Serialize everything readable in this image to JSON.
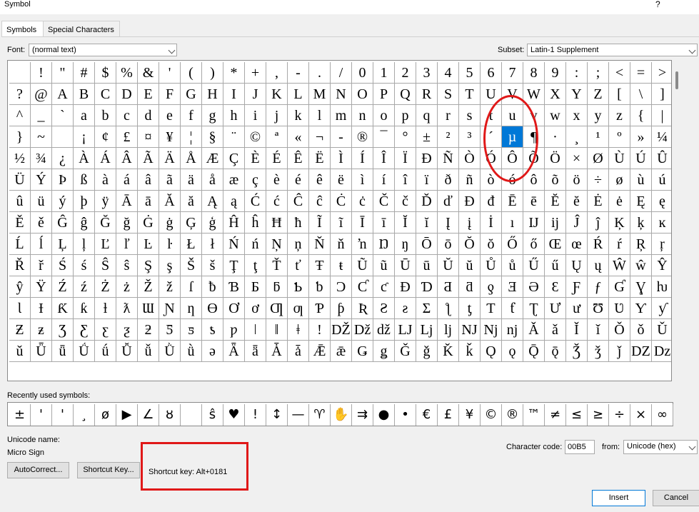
{
  "window": {
    "title": "Symbol",
    "help": "?"
  },
  "tabs": [
    {
      "label": "Symbols"
    },
    {
      "label": "Special Characters"
    }
  ],
  "font": {
    "label": "Font:",
    "value": "(normal text)"
  },
  "subset": {
    "label": "Subset:",
    "value": "Latin-1 Supplement"
  },
  "grid": {
    "rows": [
      [
        "",
        "!",
        "\"",
        "#",
        "$",
        "%",
        "&",
        "'",
        "(",
        ")",
        "*",
        "+",
        ",",
        "-",
        ".",
        "/",
        "0",
        "1",
        "2",
        "3",
        "4",
        "5",
        "6",
        "7",
        "8",
        "9",
        ":",
        ";",
        "<",
        "=",
        ">"
      ],
      [
        "?",
        "@",
        "A",
        "B",
        "C",
        "D",
        "E",
        "F",
        "G",
        "H",
        "I",
        "J",
        "K",
        "L",
        "M",
        "N",
        "O",
        "P",
        "Q",
        "R",
        "S",
        "T",
        "U",
        "V",
        "W",
        "X",
        "Y",
        "Z",
        "[",
        "\\",
        "]"
      ],
      [
        "^",
        "_",
        "`",
        "a",
        "b",
        "c",
        "d",
        "e",
        "f",
        "g",
        "h",
        "i",
        "j",
        "k",
        "l",
        "m",
        "n",
        "o",
        "p",
        "q",
        "r",
        "s",
        "t",
        "u",
        "v",
        "w",
        "x",
        "y",
        "z",
        "{",
        "|"
      ],
      [
        "}",
        "~",
        "",
        "¡",
        "¢",
        "£",
        "¤",
        "¥",
        "¦",
        "§",
        "¨",
        "©",
        "ª",
        "«",
        "¬",
        "-",
        "®",
        "¯",
        "°",
        "±",
        "²",
        "³",
        "´",
        "µ",
        "¶",
        "·",
        "¸",
        "¹",
        "º",
        "»",
        "¼"
      ],
      [
        "½",
        "¾",
        "¿",
        "À",
        "Á",
        "Â",
        "Ã",
        "Ä",
        "Å",
        "Æ",
        "Ç",
        "È",
        "É",
        "Ê",
        "Ë",
        "Ì",
        "Í",
        "Î",
        "Ï",
        "Ð",
        "Ñ",
        "Ò",
        "Ó",
        "Ô",
        "Õ",
        "Ö",
        "×",
        "Ø",
        "Ù",
        "Ú",
        "Û"
      ],
      [
        "Ü",
        "Ý",
        "Þ",
        "ß",
        "à",
        "á",
        "â",
        "ã",
        "ä",
        "å",
        "æ",
        "ç",
        "è",
        "é",
        "ê",
        "ë",
        "ì",
        "í",
        "î",
        "ï",
        "ð",
        "ñ",
        "ò",
        "ó",
        "ô",
        "õ",
        "ö",
        "÷",
        "ø",
        "ù",
        "ú"
      ],
      [
        "û",
        "ü",
        "ý",
        "þ",
        "ÿ",
        "Ā",
        "ā",
        "Ă",
        "ă",
        "Ą",
        "ą",
        "Ć",
        "ć",
        "Ĉ",
        "ĉ",
        "Ċ",
        "ċ",
        "Č",
        "č",
        "Ď",
        "ď",
        "Đ",
        "đ",
        "Ē",
        "ē",
        "Ĕ",
        "ĕ",
        "Ė",
        "ė",
        "Ę",
        "ę"
      ],
      [
        "Ě",
        "ě",
        "Ĝ",
        "ĝ",
        "Ğ",
        "ğ",
        "Ġ",
        "ġ",
        "Ģ",
        "ģ",
        "Ĥ",
        "ĥ",
        "Ħ",
        "ħ",
        "Ĩ",
        "ĩ",
        "Ī",
        "ī",
        "Ĭ",
        "ĭ",
        "Į",
        "į",
        "İ",
        "ı",
        "Ĳ",
        "ĳ",
        "Ĵ",
        "ĵ",
        "Ķ",
        "ķ",
        "ĸ"
      ],
      [
        "Ĺ",
        "ĺ",
        "Ļ",
        "ļ",
        "Ľ",
        "ľ",
        "Ŀ",
        "ŀ",
        "Ł",
        "ł",
        "Ń",
        "ń",
        "Ņ",
        "ņ",
        "Ň",
        "ň",
        "ŉ",
        "Ŋ",
        "ŋ",
        "Ō",
        "ō",
        "Ŏ",
        "ŏ",
        "Ő",
        "ő",
        "Œ",
        "œ",
        "Ŕ",
        "ŕ",
        "Ŗ",
        "ŗ"
      ],
      [
        "Ř",
        "ř",
        "Ś",
        "ś",
        "Ŝ",
        "ŝ",
        "Ş",
        "ş",
        "Š",
        "š",
        "Ţ",
        "ţ",
        "Ť",
        "ť",
        "Ŧ",
        "ŧ",
        "Ũ",
        "ũ",
        "Ū",
        "ū",
        "Ŭ",
        "ŭ",
        "Ů",
        "ů",
        "Ű",
        "ű",
        "Ų",
        "ų",
        "Ŵ",
        "ŵ",
        "Ŷ"
      ],
      [
        "ŷ",
        "Ÿ",
        "Ź",
        "ź",
        "Ż",
        "ż",
        "Ž",
        "ž",
        "ſ",
        "ƀ",
        "Ɓ",
        "Ƃ",
        "ƃ",
        "Ƅ",
        "ƅ",
        "Ɔ",
        "Ƈ",
        "ƈ",
        "Ɖ",
        "Ɗ",
        "Ƌ",
        "ƌ",
        "ƍ",
        "Ǝ",
        "Ə",
        "Ɛ",
        "Ƒ",
        "ƒ",
        "Ɠ",
        "Ɣ",
        "ƕ"
      ],
      [
        "Ɩ",
        "Ɨ",
        "Ƙ",
        "ƙ",
        "ƚ",
        "ƛ",
        "Ɯ",
        "Ɲ",
        "ƞ",
        "Ɵ",
        "Ơ",
        "ơ",
        "Ƣ",
        "ƣ",
        "Ƥ",
        "ƥ",
        "Ʀ",
        "Ƨ",
        "ƨ",
        "Ʃ",
        "ƪ",
        "ƫ",
        "Ƭ",
        "ƭ",
        "Ʈ",
        "Ư",
        "ư",
        "Ʊ",
        "Ʋ",
        "Ƴ",
        "ƴ"
      ],
      [
        "Ƶ",
        "ƶ",
        "Ʒ",
        "Ƹ",
        "ƹ",
        "ƺ",
        "ƻ",
        "Ƽ",
        "ƽ",
        "ƾ",
        "ƿ",
        "ǀ",
        "ǁ",
        "ǂ",
        "ǃ",
        "Ǆ",
        "ǅ",
        "ǆ",
        "Ǉ",
        "ǈ",
        "ǉ",
        "Ǌ",
        "ǋ",
        "ǌ",
        "Ǎ",
        "ǎ",
        "Ǐ",
        "ǐ",
        "Ǒ",
        "ǒ",
        "Ǔ"
      ],
      [
        "ǔ",
        "Ǖ",
        "ǖ",
        "Ǘ",
        "ǘ",
        "Ǚ",
        "ǚ",
        "Ǜ",
        "ǜ",
        "ǝ",
        "Ǟ",
        "ǟ",
        "Ǡ",
        "ǡ",
        "Ǣ",
        "ǣ",
        "Ǥ",
        "ǥ",
        "Ǧ",
        "ǧ",
        "Ǩ",
        "ǩ",
        "Ǫ",
        "ǫ",
        "Ǭ",
        "ǭ",
        "Ǯ",
        "ǯ",
        "ǰ",
        "Ǳ",
        "ǲ"
      ]
    ],
    "selected": "µ"
  },
  "recent": {
    "label": "Recently used symbols:",
    "symbols": [
      "±",
      "'",
      "'",
      "¸",
      "ø",
      "▶",
      "∠",
      "ȣ",
      "",
      "ŝ",
      "♥",
      "!",
      "↕",
      "—",
      "♈",
      "✋",
      "⇉",
      "●",
      "•",
      "€",
      "£",
      "¥",
      "©",
      "®",
      "™",
      "≠",
      "≤",
      "≥",
      "÷",
      "×",
      "∞"
    ]
  },
  "unicode_name": {
    "label": "Unicode name:",
    "value": "Micro Sign"
  },
  "character_code": {
    "label": "Character code:",
    "value": "00B5"
  },
  "from": {
    "label": "from:",
    "value": "Unicode (hex)"
  },
  "buttons": {
    "autocorrect": "AutoCorrect...",
    "shortcut_key": "Shortcut Key...",
    "insert": "Insert",
    "cancel": "Cancel"
  },
  "shortcut_key_text": "Shortcut key: Alt+0181",
  "annotation_color": "#e01818",
  "selection_color": "#0078d7"
}
